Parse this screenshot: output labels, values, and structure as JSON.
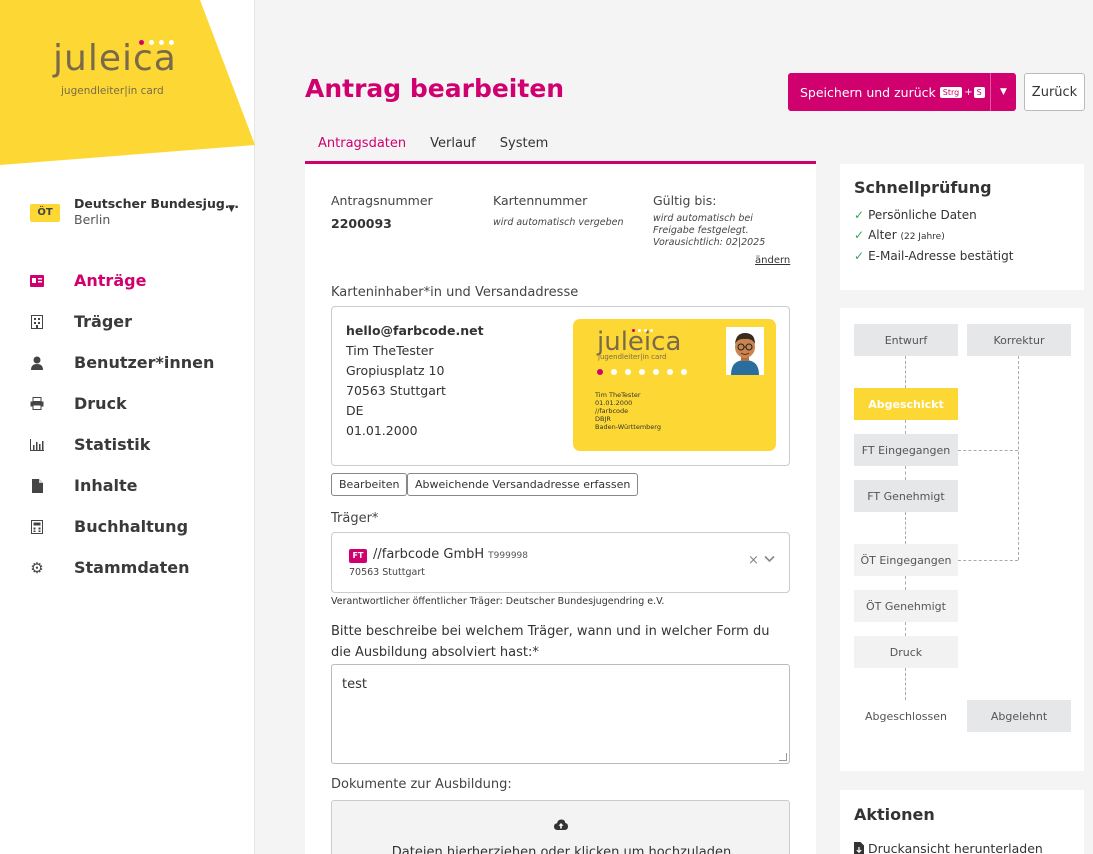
{
  "brand": {
    "logo": "juleica",
    "logo_sub": "jugendleiter|in card",
    "accent": "#d0006f",
    "yellow": "#fdd835"
  },
  "org": {
    "badge": "ÖT",
    "name": "Deutscher Bundesjug...",
    "city": "Berlin"
  },
  "nav": [
    {
      "label": "Anträge",
      "icon": "id-card-icon",
      "active": true
    },
    {
      "label": "Träger",
      "icon": "building-icon"
    },
    {
      "label": "Benutzer*innen",
      "icon": "user-icon"
    },
    {
      "label": "Druck",
      "icon": "printer-icon"
    },
    {
      "label": "Statistik",
      "icon": "bar-chart-icon"
    },
    {
      "label": "Inhalte",
      "icon": "file-icon"
    },
    {
      "label": "Buchhaltung",
      "icon": "calculator-icon"
    },
    {
      "label": "Stammdaten",
      "icon": "gear-icon"
    }
  ],
  "header": {
    "title": "Antrag bearbeiten",
    "save_label": "Speichern und zurück",
    "save_kbd1": "Strg",
    "save_kbd_sep": "+",
    "save_kbd2": "S",
    "back_label": "Zurück"
  },
  "tabs": [
    "Antragsdaten",
    "Verlauf",
    "System"
  ],
  "form": {
    "antragsnummer_label": "Antragsnummer",
    "antragsnummer": "2200093",
    "kartennummer_label": "Kartennummer",
    "kartennummer": "wird automatisch vergeben",
    "gueltig_label": "Gültig bis:",
    "gueltig_line1": "wird automatisch bei",
    "gueltig_line2": "Freigabe festgelegt.",
    "gueltig_line3": "Vorausichtlich: 02|2025",
    "aendern": "ändern",
    "address_section": "Karteninhaber*in und Versandadresse",
    "address": {
      "email": "hello@farbcode.net",
      "name": "Tim TheTester",
      "street": "Gropiusplatz 10",
      "city": "70563 Stuttgart",
      "country": "DE",
      "birth": "01.01.2000"
    },
    "card": {
      "logo": "juleica",
      "sub": "jugendleiter|in card",
      "name": "Tim TheTester",
      "birth": "01.01.2000",
      "org": "//farbcode",
      "verband": "DBJR",
      "land": "Baden-Württemberg"
    },
    "edit_button": "Bearbeiten",
    "alt_address_button": "Abweichende Versandadresse erfassen",
    "traeger_label": "Träger*",
    "traeger": {
      "badge": "FT",
      "name": "//farbcode GmbH",
      "number": "T999998",
      "city": "70563 Stuttgart"
    },
    "responsible_note": "Verantwortlicher öffentlicher Träger: Deutscher Bundesjugendring e.V.",
    "question": "Bitte beschreibe bei welchem Träger, wann und in welcher Form du die Ausbildung absolviert hast:*",
    "answer": "test",
    "docs_label": "Dokumente zur Ausbildung:",
    "dropzone_text": "Dateien hierherziehen oder klicken um hochzuladen"
  },
  "quickcheck": {
    "title": "Schnellprüfung",
    "items": [
      {
        "label": "Persönliche Daten",
        "extra": ""
      },
      {
        "label": "Alter",
        "extra": "(22 Jahre)"
      },
      {
        "label": "E-Mail-Adresse bestätigt",
        "extra": ""
      }
    ]
  },
  "workflow": {
    "entwurf": "Entwurf",
    "korrektur": "Korrektur",
    "abgeschickt": "Abgeschickt",
    "ft_eingegangen": "FT Eingegangen",
    "ft_genehmigt": "FT Genehmigt",
    "oet_eingegangen": "ÖT Eingegangen",
    "oet_genehmigt": "ÖT Genehmigt",
    "druck": "Druck",
    "abgeschlossen": "Abgeschlossen",
    "abgelehnt": "Abgelehnt"
  },
  "actions": {
    "title": "Aktionen",
    "download": "Druckansicht herunterladen"
  }
}
